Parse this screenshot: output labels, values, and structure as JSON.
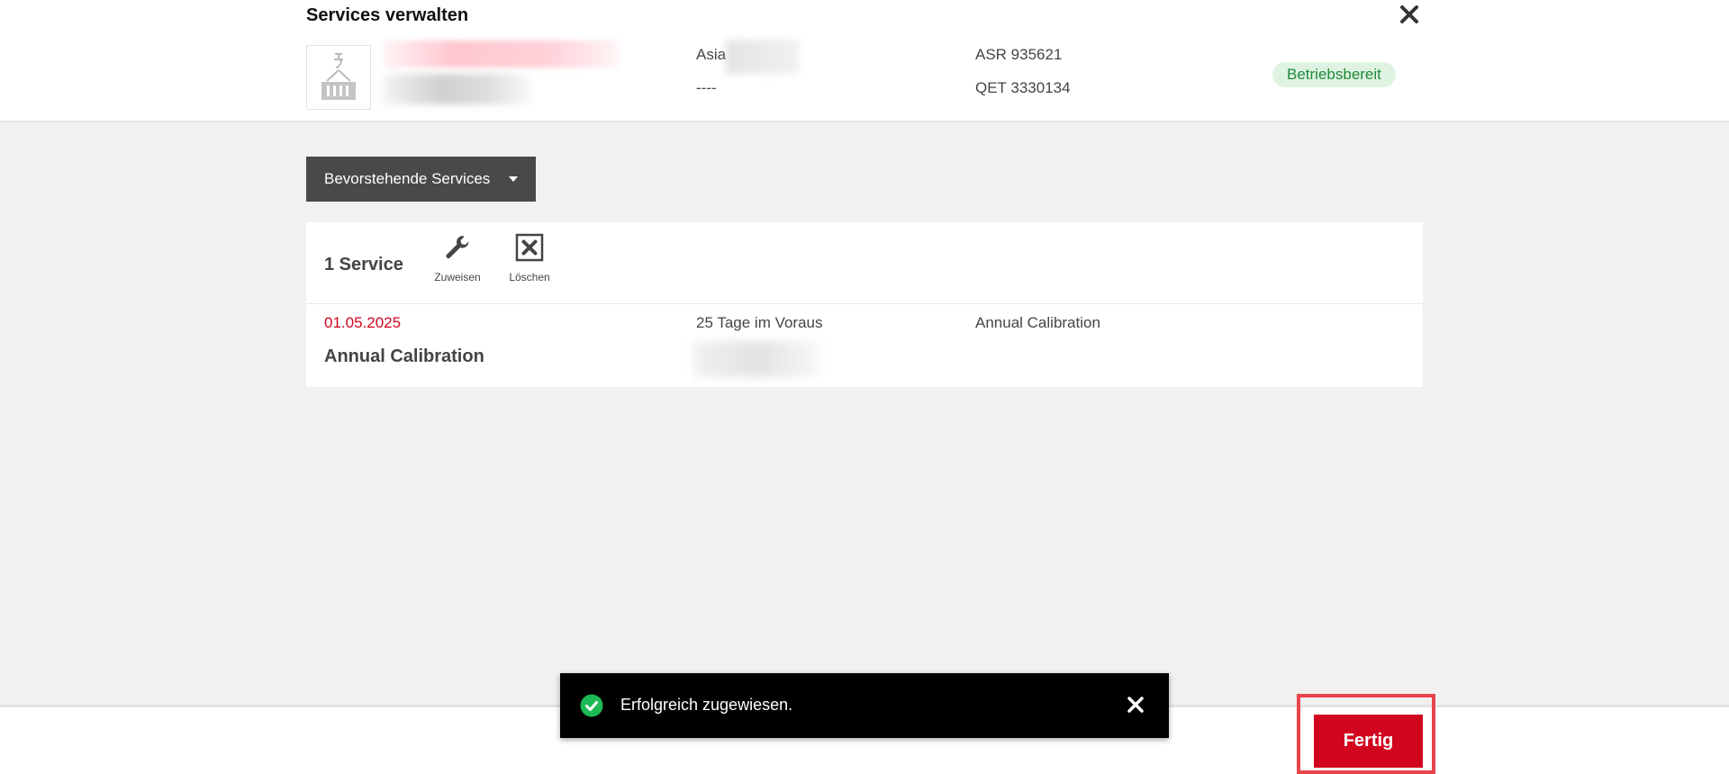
{
  "header": {
    "title": "Services verwalten",
    "location": "Asia",
    "location_secondary": "----",
    "serial_1": "ASR 935621",
    "serial_2": "QET 3330134",
    "status": "Betriebsbereit"
  },
  "dropdown": {
    "label": "Bevorstehende Services"
  },
  "toolbar": {
    "count_label": "1 Service",
    "assign_label": "Zuweisen",
    "delete_label": "Löschen"
  },
  "services": [
    {
      "date": "01.05.2025",
      "title": "Annual Calibration",
      "advance": "25 Tage im Voraus",
      "type": "Annual Calibration"
    }
  ],
  "toast": {
    "message": "Erfolgreich zugewiesen."
  },
  "footer": {
    "done_label": "Fertig"
  },
  "colors": {
    "accent_red": "#d2051e",
    "status_green": "#1f8a3a",
    "success_icon": "#1db954"
  },
  "icons": {
    "close": "close-icon",
    "asset": "crane-container-icon",
    "assign": "wrench-icon",
    "delete": "delete-box-icon",
    "success": "check-circle-icon",
    "dropdown": "caret-down-icon"
  }
}
